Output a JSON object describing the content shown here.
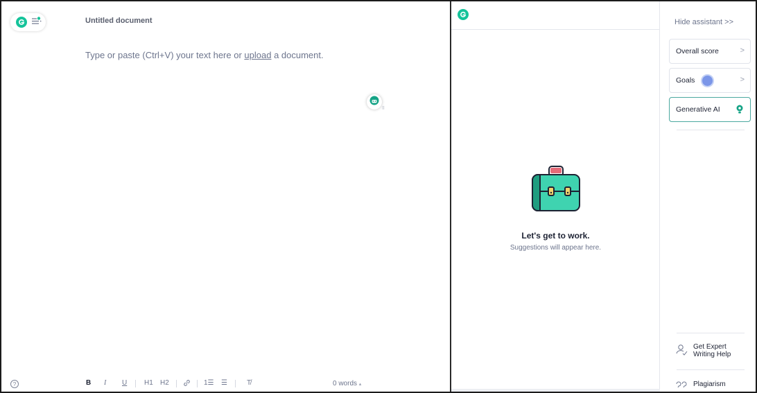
{
  "editor": {
    "title": "Untitled document",
    "placeholder_before": "Type or paste (Ctrl+V) your text here or ",
    "upload_link": "upload",
    "placeholder_after": " a document."
  },
  "toolbar": {
    "help": "?",
    "bold": "B",
    "italic": "I",
    "underline": "U",
    "h1": "H1",
    "h2": "H2",
    "ordered_list": "1☰",
    "bullet_list": "☰",
    "clear_format": "T̸",
    "word_count": "0 words",
    "word_count_caret": "▴"
  },
  "suggestions": {
    "empty_title": "Let's get to work.",
    "empty_subtitle": "Suggestions will appear here."
  },
  "assistant": {
    "hide_label": "Hide assistant",
    "hide_chevrons": ">>",
    "cards": [
      {
        "label": "Overall score"
      },
      {
        "label": "Goals"
      },
      {
        "label": "Generative AI"
      }
    ],
    "chevron": ">",
    "expert_line1": "Get Expert",
    "expert_line2": "Writing Help",
    "plagiarism": "Plagiarism"
  },
  "colors": {
    "brand_green": "#15c39a",
    "briefcase_body": "#3fd3b0",
    "briefcase_dark": "#1f9d80",
    "briefcase_handle": "#e56b78",
    "latch": "#f3d36b",
    "goals_dot": "#7b96e8"
  }
}
